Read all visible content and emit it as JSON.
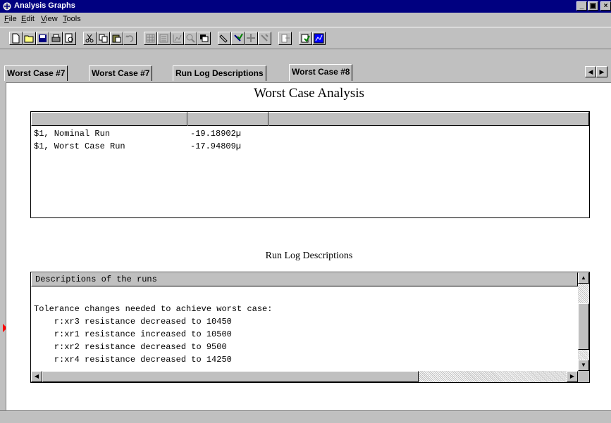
{
  "window": {
    "title": "Analysis Graphs",
    "buttons": {
      "minimize": "_",
      "maximize": "▣",
      "close": "×"
    }
  },
  "menu": [
    {
      "label": "File",
      "accel": "F",
      "rest": "ile"
    },
    {
      "label": "Edit",
      "accel": "E",
      "rest": "dit"
    },
    {
      "label": "View",
      "accel": "V",
      "rest": "iew"
    },
    {
      "label": "Tools",
      "accel": "T",
      "rest": "ools"
    }
  ],
  "toolbar": {
    "icons": [
      "new-icon",
      "open-icon",
      "save-icon",
      "print-icon",
      "print-preview-icon",
      "cut-icon",
      "copy-icon",
      "paste-icon",
      "undo-icon",
      "grid-icon",
      "list-icon",
      "chart-icon",
      "zoom-icon",
      "window-icon",
      "marker-icon",
      "check-marker-icon",
      "move-icon",
      "edit-marker-icon",
      "export-icon",
      "report-icon",
      "graph-icon"
    ]
  },
  "tabs": [
    {
      "label": "Worst Case #7",
      "active": false
    },
    {
      "label": "Worst Case #7",
      "active": false
    },
    {
      "label": "Run Log Descriptions",
      "active": false
    },
    {
      "label": "Worst Case #8",
      "active": true
    }
  ],
  "analysis": {
    "title": "Worst Case Analysis",
    "columns": [
      "",
      "",
      ""
    ],
    "rows": [
      {
        "name": "$1, Nominal Run",
        "value": "-19.18902µ"
      },
      {
        "name": "$1, Worst Case Run",
        "value": "-17.94809µ"
      }
    ]
  },
  "runlog": {
    "title": "Run Log Descriptions",
    "header": "Descriptions of the runs",
    "lines": [
      "Tolerance changes needed to achieve worst case:",
      "    r:xr3 resistance decreased to 10450",
      "    r:xr1 resistance increased to 10500",
      "    r:xr2 resistance decreased to 9500",
      "    r:xr4 resistance decreased to 14250"
    ]
  },
  "colors": {
    "titlebar": "#000080",
    "chrome": "#c0c0c0",
    "panel": "#ffffff",
    "marker": "#ff0000"
  }
}
